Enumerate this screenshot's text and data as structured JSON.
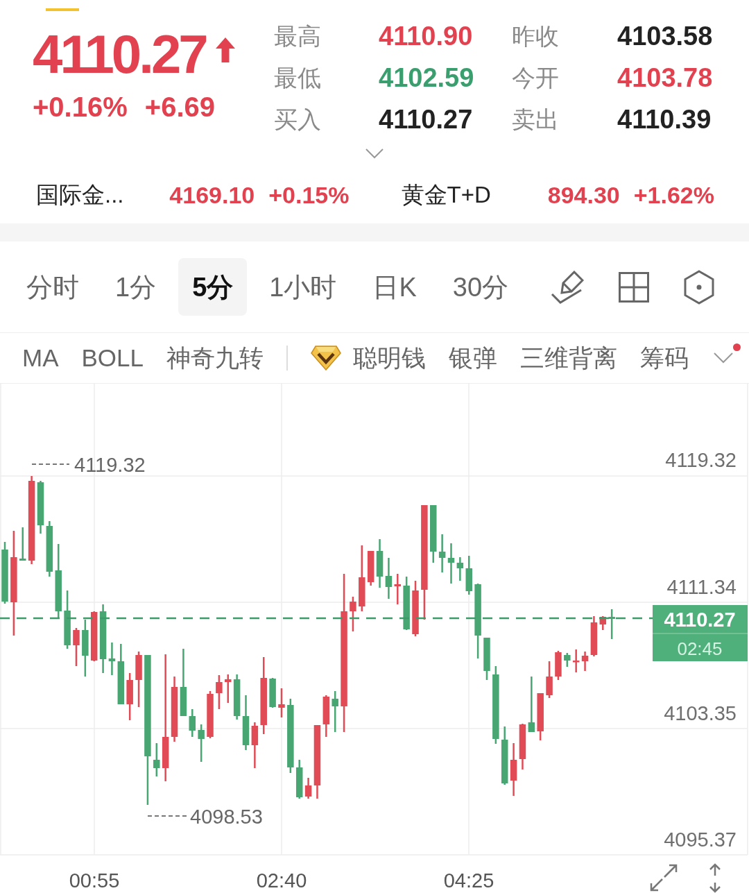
{
  "quote": {
    "price": "4110.27",
    "rising": true,
    "change_percent": "+0.16%",
    "change": "+6.69"
  },
  "stats": [
    {
      "label": "最高",
      "value": "4110.90",
      "color": "#e2424f"
    },
    {
      "label": "昨收",
      "value": "4103.58",
      "color": "#222222"
    },
    {
      "label": "最低",
      "value": "4102.59",
      "color": "#3a9e6e"
    },
    {
      "label": "今开",
      "value": "4103.78",
      "color": "#e2424f"
    },
    {
      "label": "买入",
      "value": "4110.27",
      "color": "#222222"
    },
    {
      "label": "卖出",
      "value": "4110.39",
      "color": "#222222"
    }
  ],
  "related": [
    {
      "name": "国际金...",
      "price": "4169.10",
      "change": "+0.15%",
      "color": "#e2424f"
    },
    {
      "name": "黄金T+D",
      "price": "894.30",
      "change": "+1.62%",
      "color": "#e2424f"
    }
  ],
  "period_tabs": [
    {
      "label": "分时",
      "selected": false
    },
    {
      "label": "1分",
      "selected": false
    },
    {
      "label": "5分",
      "selected": true
    },
    {
      "label": "1小时",
      "selected": false
    },
    {
      "label": "日K",
      "selected": false
    },
    {
      "label": "30分",
      "selected": false
    }
  ],
  "indicators": [
    {
      "label": "MA",
      "kind": "basic"
    },
    {
      "label": "BOLL",
      "kind": "basic"
    },
    {
      "label": "神奇九转",
      "kind": "basic"
    },
    {
      "label": "聪明钱",
      "kind": "premium"
    },
    {
      "label": "银弹",
      "kind": "premium"
    },
    {
      "label": "三维背离",
      "kind": "premium"
    },
    {
      "label": "筹码",
      "kind": "premium"
    }
  ],
  "indicator_menu": {
    "notification": true
  },
  "chart": {
    "high_label": "4119.32",
    "low_label": "4098.53",
    "y_labels": [
      "4119.32",
      "4111.34",
      "4103.35",
      "4095.37"
    ],
    "x_labels": [
      "00:55",
      "02:40",
      "04:25"
    ],
    "price_tag": {
      "price": "4110.27",
      "countdown": "02:45"
    }
  }
}
